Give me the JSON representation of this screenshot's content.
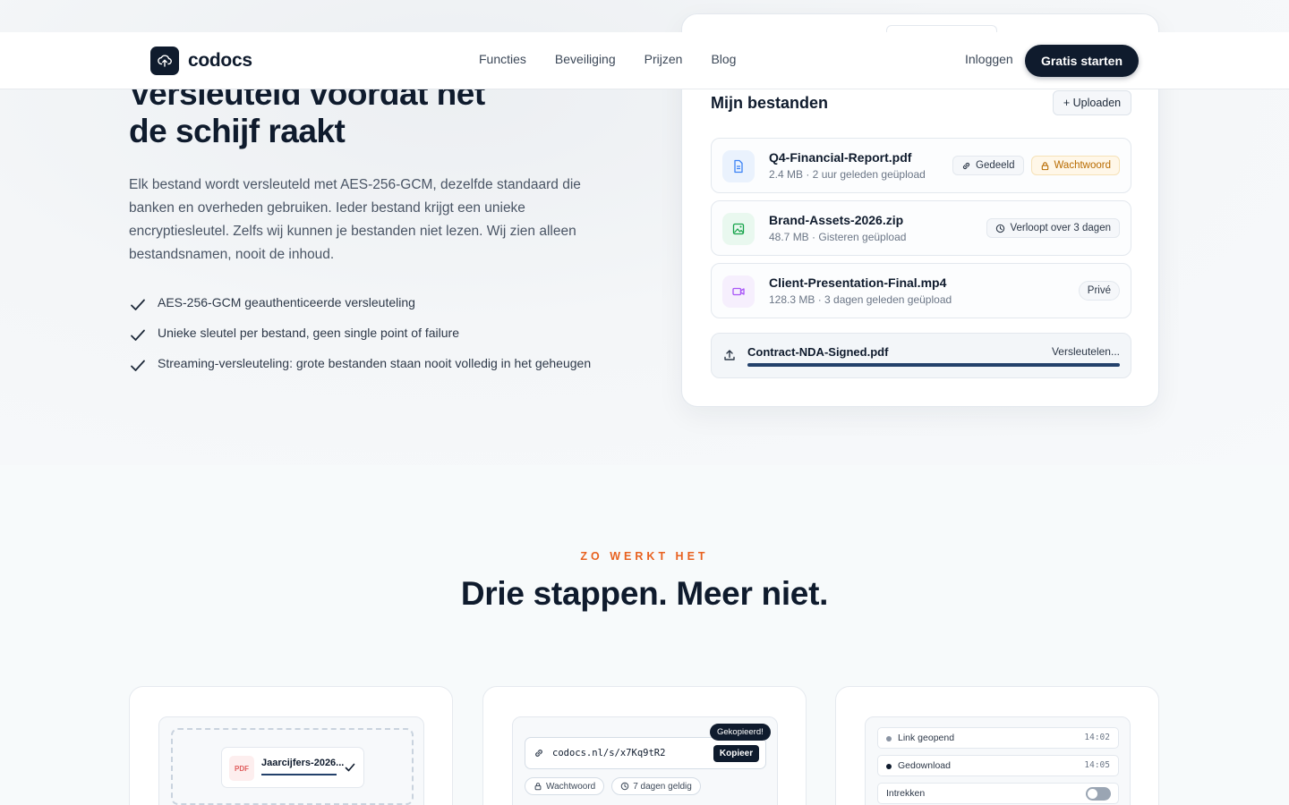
{
  "header": {
    "logo_text": "codocs",
    "nav": [
      "Functies",
      "Beveiliging",
      "Prijzen",
      "Blog"
    ],
    "login": "Inloggen",
    "cta": "Gratis starten"
  },
  "hero": {
    "title_line1": "Versleuteld voordat het",
    "title_line2": "de schijf raakt",
    "description": "Elk bestand wordt versleuteld met AES-256-GCM, dezelfde standaard die banken en overheden gebruiken. Ieder bestand krijgt een unieke encryptiesleutel. Zelfs wij kunnen je bestanden niet lezen. Wij zien alleen bestandsnamen, nooit de inhoud.",
    "features": [
      "AES-256-GCM geauthenticeerde versleuteling",
      "Unieke sleutel per bestand, geen single point of failure",
      "Streaming-versleuteling: grote bestanden staan nooit volledig in het geheugen"
    ]
  },
  "files_panel": {
    "title": "Mijn bestanden",
    "upload_button": "+ Uploaden",
    "files": [
      {
        "name": "Q4-Financial-Report.pdf",
        "meta": "2.4 MB · 2 uur geleden geüpload",
        "icon": "document-icon",
        "badges": [
          "Gedeeld",
          "Wachtwoord"
        ]
      },
      {
        "name": "Brand-Assets-2026.zip",
        "meta": "48.7 MB · Gisteren geüpload",
        "icon": "image-icon",
        "badges": [
          "Verloopt over 3 dagen"
        ]
      },
      {
        "name": "Client-Presentation-Final.mp4",
        "meta": "128.3 MB · 3 dagen geleden geüpload",
        "icon": "video-icon",
        "badges": [
          "Privé"
        ]
      }
    ],
    "uploading": {
      "name": "Contract-NDA-Signed.pdf",
      "status": "Versleutelen...",
      "progress": 1.0
    }
  },
  "how_it_works": {
    "eyebrow": "ZO WERKT HET",
    "title": "Drie stappen. Meer niet.",
    "step1": {
      "file_type": "PDF",
      "file_name": "Jaarcijfers-2026..."
    },
    "step2": {
      "link": "codocs.nl/s/x7Kq9tR2",
      "copy_button": "Kopieer",
      "copied_tooltip": "Gekopieerd!",
      "chips": [
        "Wachtwoord",
        "7 dagen geldig"
      ]
    },
    "step3": {
      "log": [
        {
          "label": "Link geopend",
          "time": "14:02"
        },
        {
          "label": "Gedownload",
          "time": "14:05"
        }
      ],
      "revoke_label": "Intrekken"
    }
  },
  "colors": {
    "brand": "#0f1b2d",
    "accent": "#e8611f",
    "progress": "#23416b"
  }
}
